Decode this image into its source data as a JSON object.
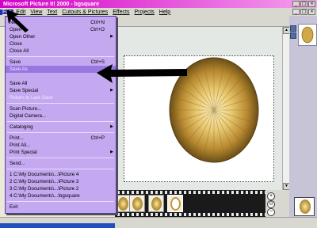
{
  "window": {
    "title": "Microsoft Picture It! 2000 - bgsquare",
    "controls": {
      "minimize": "_",
      "maximize": "□",
      "close": "×"
    }
  },
  "menubar": {
    "items": [
      "File",
      "Edit",
      "View",
      "Text",
      "Cutouts & Pictures",
      "Effects",
      "Projects",
      "Help"
    ],
    "active_index": 0
  },
  "file_menu": {
    "groups": [
      [
        {
          "label": "New",
          "shortcut": "Ctrl+N",
          "disabled": false,
          "submenu": false
        },
        {
          "label": "Open",
          "shortcut": "Ctrl+O",
          "disabled": false,
          "submenu": false
        },
        {
          "label": "Open Other",
          "shortcut": "",
          "disabled": false,
          "submenu": true
        },
        {
          "label": "Close",
          "shortcut": "",
          "disabled": false,
          "submenu": false
        },
        {
          "label": "Close All",
          "shortcut": "",
          "disabled": false,
          "submenu": false
        }
      ],
      [
        {
          "label": "Save",
          "shortcut": "Ctrl+S",
          "disabled": false,
          "submenu": false
        },
        {
          "label": "Save As",
          "shortcut": "",
          "disabled": true,
          "submenu": false
        },
        {
          "label": "",
          "shortcut": "",
          "disabled": false,
          "submenu": false
        },
        {
          "label": "Save All",
          "shortcut": "",
          "disabled": false,
          "submenu": false
        },
        {
          "label": "Save Special",
          "shortcut": "",
          "disabled": false,
          "submenu": true
        },
        {
          "label": "Return to Last Save",
          "shortcut": "",
          "disabled": true,
          "submenu": false
        }
      ],
      [
        {
          "label": "Scan Picture...",
          "shortcut": "",
          "disabled": false,
          "submenu": false
        },
        {
          "label": "Digital Camera...",
          "shortcut": "",
          "disabled": false,
          "submenu": false
        }
      ],
      [
        {
          "label": "Cataloging",
          "shortcut": "",
          "disabled": false,
          "submenu": true
        }
      ],
      [
        {
          "label": "Print...",
          "shortcut": "Ctrl+P",
          "disabled": false,
          "submenu": false
        },
        {
          "label": "Print All...",
          "shortcut": "",
          "disabled": false,
          "submenu": false
        },
        {
          "label": "Print Special",
          "shortcut": "",
          "disabled": false,
          "submenu": true
        }
      ],
      [
        {
          "label": "Send...",
          "shortcut": "",
          "disabled": false,
          "submenu": false
        }
      ],
      [
        {
          "label": "1 C:\\My Documents\\...\\Picture 4",
          "shortcut": "",
          "disabled": false,
          "submenu": false
        },
        {
          "label": "2 C:\\My Documents\\...\\Picture 3",
          "shortcut": "",
          "disabled": false,
          "submenu": false
        },
        {
          "label": "3 C:\\My Documents\\...\\Picture 2",
          "shortcut": "",
          "disabled": false,
          "submenu": false
        },
        {
          "label": "4 C:\\My Documents\\...\\bgsquare",
          "shortcut": "",
          "disabled": false,
          "submenu": false
        }
      ],
      [
        {
          "label": "Exit",
          "shortcut": "",
          "disabled": false,
          "submenu": false
        }
      ]
    ]
  },
  "zoom": {
    "in": "+",
    "out": "−",
    "fit": "⊙"
  },
  "colors": {
    "title_gradient_start": "#d400c8",
    "menu_background": "#c4a8f0",
    "gold": "#c09a40",
    "annotation_arrow": "#000000"
  },
  "icons": [
    "film-thumb-icon",
    "zoom-in-icon",
    "zoom-out-icon",
    "pointer-arrow-icon"
  ]
}
